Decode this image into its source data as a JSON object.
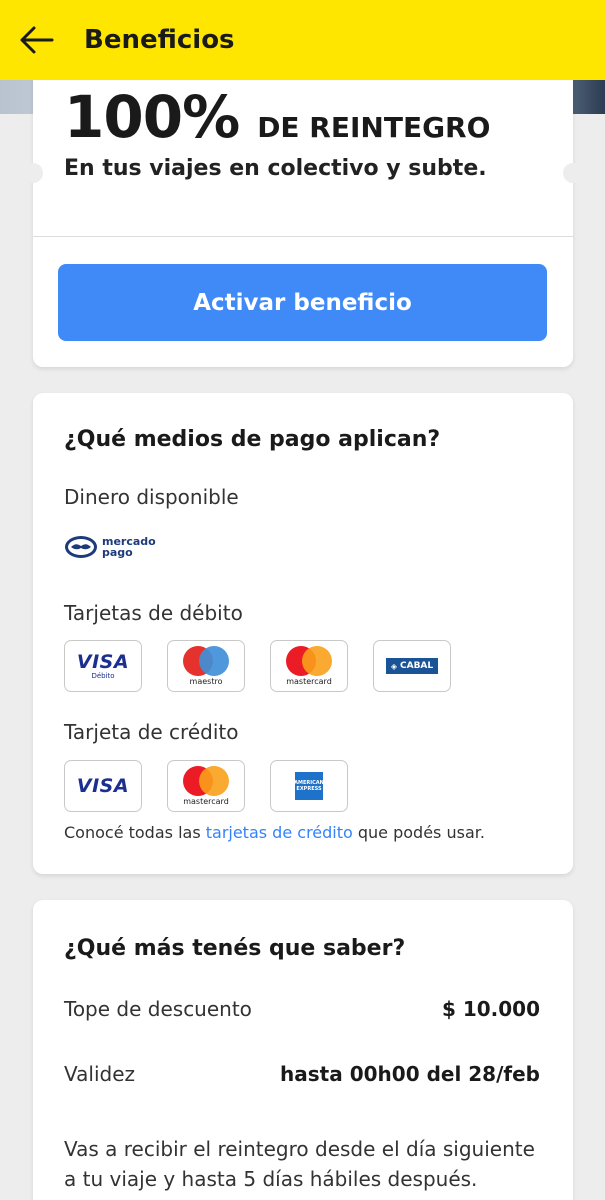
{
  "header": {
    "title": "Beneficios"
  },
  "hero": {
    "percent": "100%",
    "percent_label": "DE REINTEGRO",
    "subtitle": "En tus viajes en colectivo y subte.",
    "cta_label": "Activar beneficio"
  },
  "payments": {
    "title": "¿Qué medios de pago aplican?",
    "money_label": "Dinero disponible",
    "mp_logo_text_1": "mercado",
    "mp_logo_text_2": "pago",
    "debit_label": "Tarjetas de débito",
    "debit_cards": [
      {
        "name": "VISA",
        "sub": "Débito"
      },
      {
        "name": "maestro"
      },
      {
        "name": "mastercard"
      },
      {
        "name": "CABAL"
      }
    ],
    "credit_label": "Tarjeta de crédito",
    "credit_cards": [
      {
        "name": "VISA"
      },
      {
        "name": "mastercard"
      },
      {
        "name": "AMERICAN EXPRESS"
      }
    ],
    "note_prefix": "Conocé todas las ",
    "note_link": "tarjetas de crédito",
    "note_suffix": " que podés usar."
  },
  "info": {
    "title": "¿Qué más tenés que saber?",
    "rows": [
      {
        "key": "Tope de descuento",
        "value": "$ 10.000"
      },
      {
        "key": "Validez",
        "value": "hasta 00h00 del 28/feb"
      }
    ],
    "paragraph": "Vas a recibir el reintegro desde el día siguiente a tu viaje y hasta 5 días hábiles después."
  },
  "colors": {
    "brand_yellow": "#ffe600",
    "button_blue": "#3f8af7",
    "link_blue": "#3483fa"
  }
}
